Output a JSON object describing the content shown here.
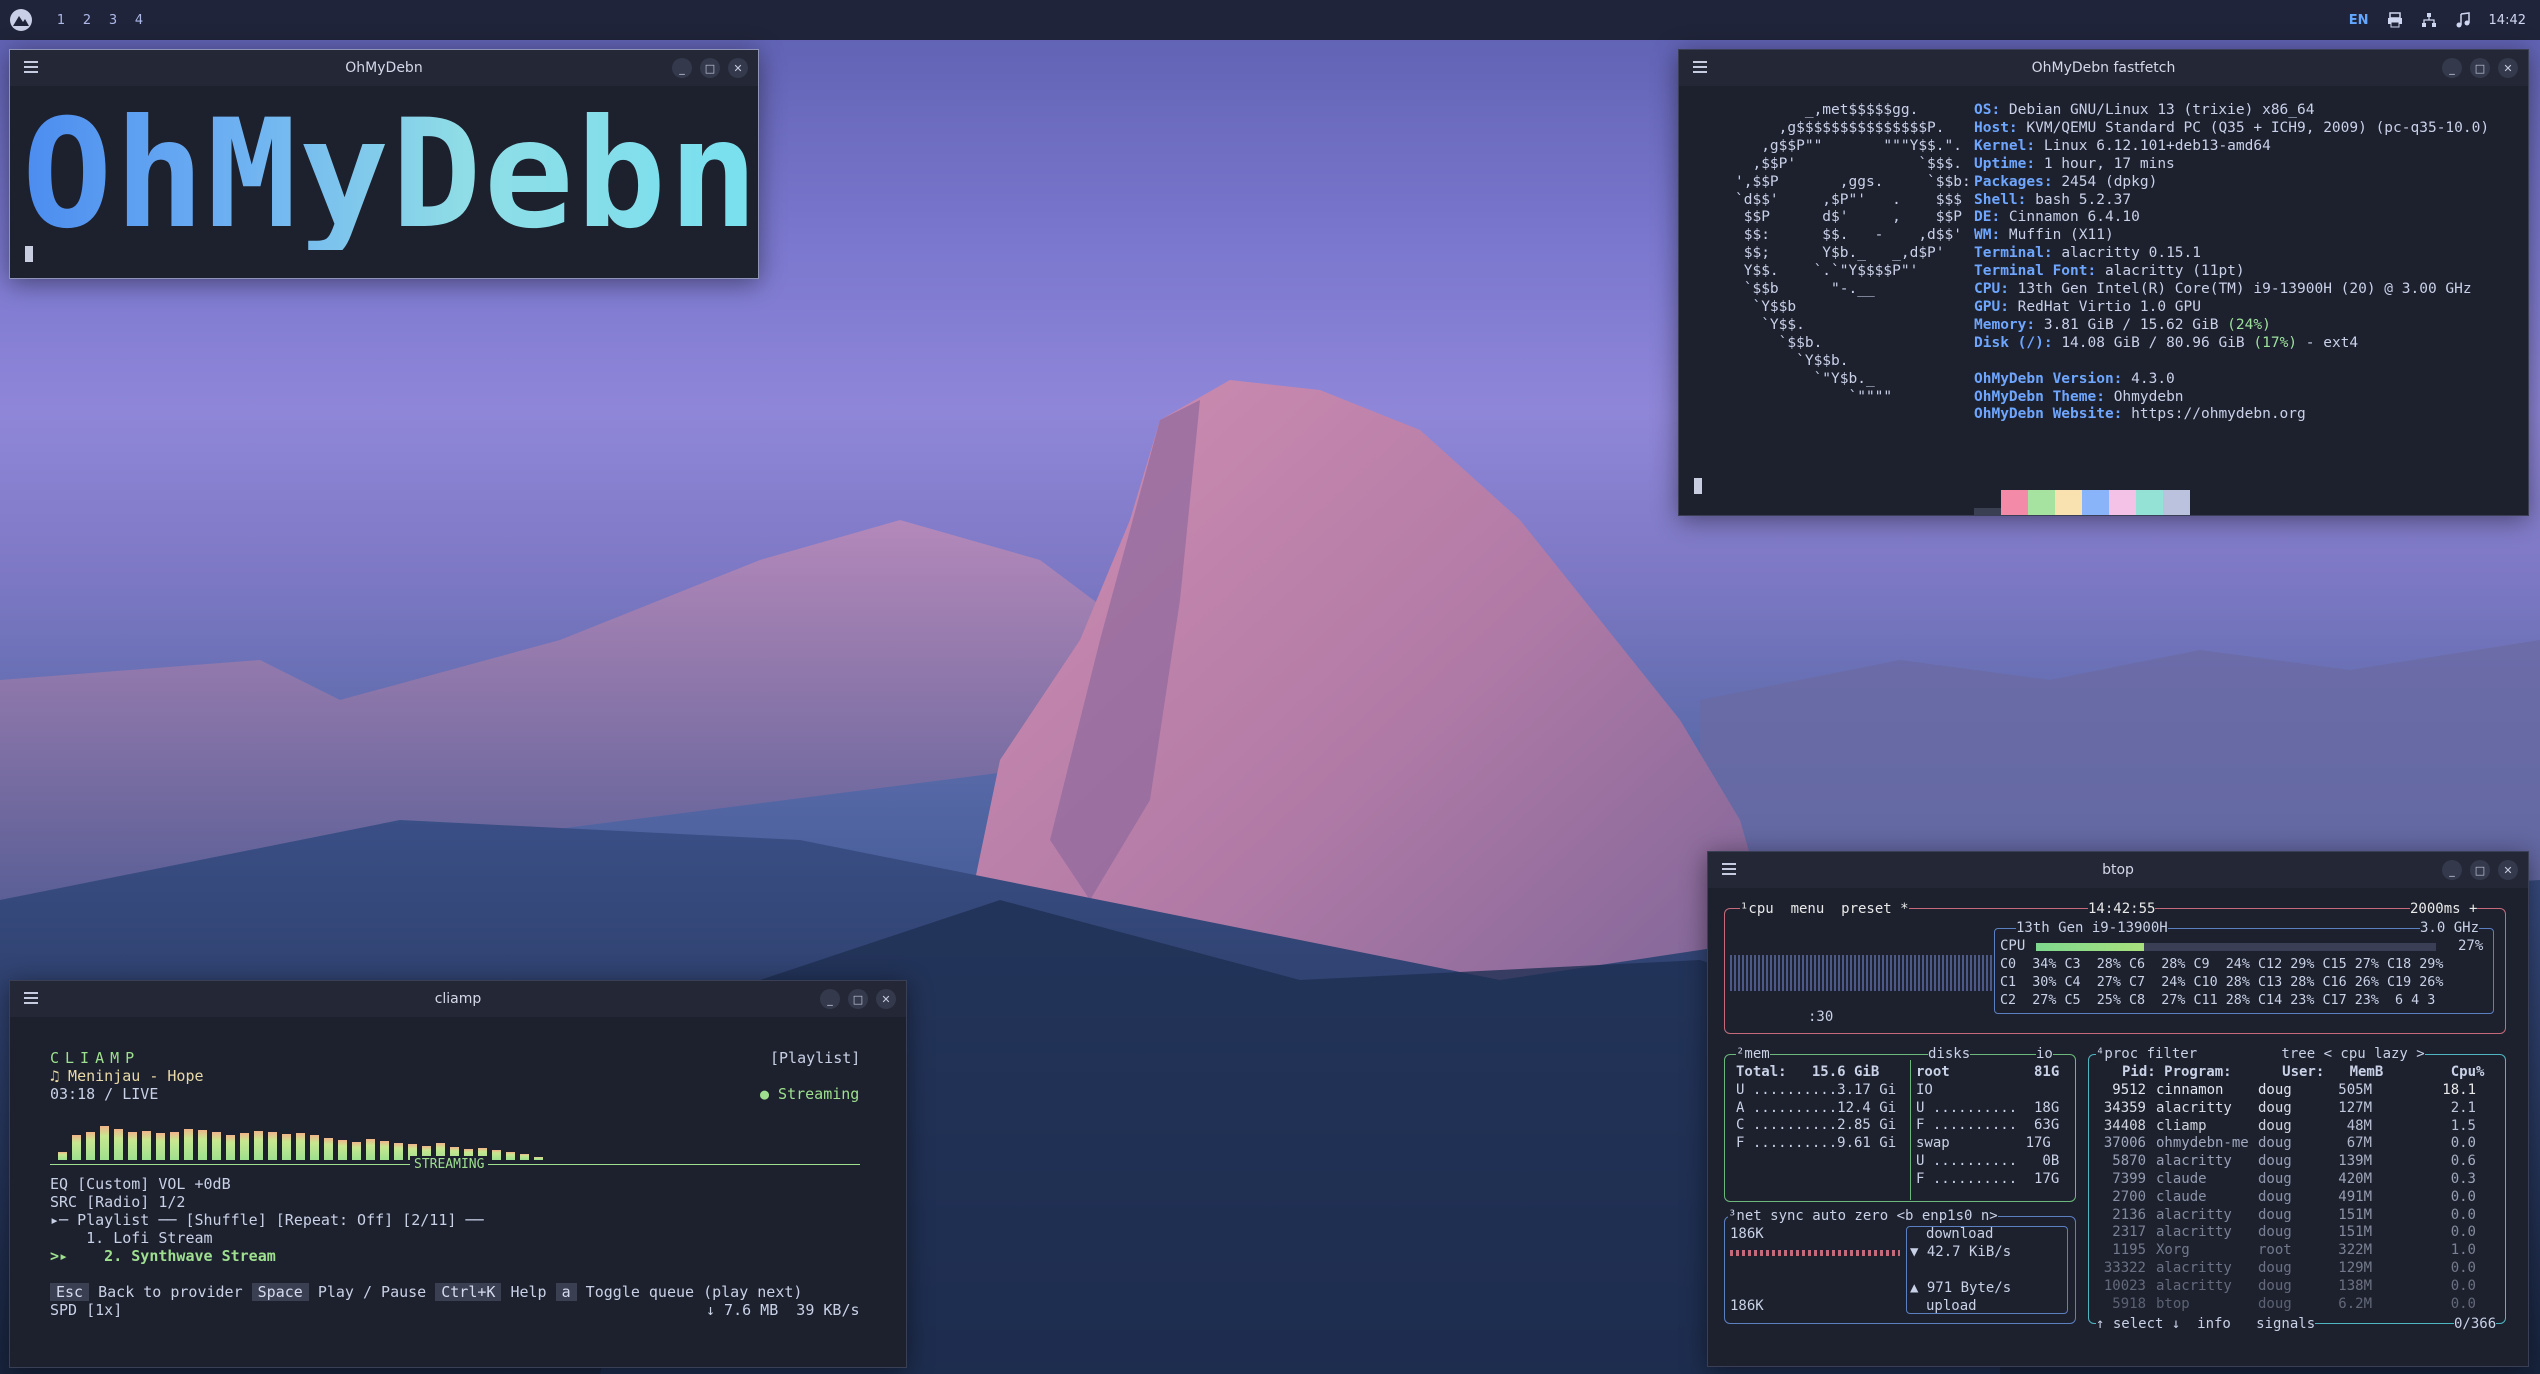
{
  "panel": {
    "workspaces": [
      "1",
      "2",
      "3",
      "4"
    ],
    "language": "EN",
    "clock": "14:42",
    "tray_icons": [
      "printer-icon",
      "network-icon",
      "music-icon"
    ]
  },
  "logo_window": {
    "title": "OhMyDebn",
    "big_text": "OhMyDebn"
  },
  "fastfetch_window": {
    "title": "OhMyDebn fastfetch",
    "ascii": [
      "        _,met$$$$$gg.",
      "     ,g$$$$$$$$$$$$$$$P.",
      "   ,g$$P\"\"       \"\"\"Y$$.\".",
      "  ,$$P'              `$$$.",
      "',$$P       ,ggs.     `$$b:",
      "`d$$'     ,$P\"'   .    $$$",
      " $$P      d$'     ,    $$P",
      " $$:      $$.   -    ,d$$'",
      " $$;      Y$b._   _,d$P'",
      " Y$$.    `.`\"Y$$$$P\"'",
      " `$$b      \"-.__",
      "  `Y$$b",
      "   `Y$$.",
      "     `$$b.",
      "       `Y$$b.",
      "         `\"Y$b._",
      "             `\"\"\"\""
    ],
    "info": [
      {
        "k": "OS",
        "v": "Debian GNU/Linux 13 (trixie) x86_64"
      },
      {
        "k": "Host",
        "v": "KVM/QEMU Standard PC (Q35 + ICH9, 2009) (pc-q35-10.0)"
      },
      {
        "k": "Kernel",
        "v": "Linux 6.12.101+deb13-amd64"
      },
      {
        "k": "Uptime",
        "v": "1 hour, 17 mins"
      },
      {
        "k": "Packages",
        "v": "2454 (dpkg)"
      },
      {
        "k": "Shell",
        "v": "bash 5.2.37"
      },
      {
        "k": "DE",
        "v": "Cinnamon 6.4.10"
      },
      {
        "k": "WM",
        "v": "Muffin (X11)"
      },
      {
        "k": "Terminal",
        "v": "alacritty 0.15.1"
      },
      {
        "k": "Terminal Font",
        "v": "alacritty (11pt)"
      },
      {
        "k": "CPU",
        "v": "13th Gen Intel(R) Core(TM) i9-13900H (20) @ 3.00 GHz"
      },
      {
        "k": "GPU",
        "v": "RedHat Virtio 1.0 GPU"
      },
      {
        "k": "Memory",
        "v": "3.81 GiB / 15.62 GiB ",
        "p": "(24%)"
      },
      {
        "k": "Disk (/)",
        "v": "14.08 GiB / 80.96 GiB ",
        "p": "(17%)",
        "t": " - ext4"
      }
    ],
    "extra": [
      {
        "k": "OhMyDebn Version",
        "v": "4.3.0"
      },
      {
        "k": "OhMyDebn Theme",
        "v": "Ohmydebn"
      },
      {
        "k": "OhMyDebn Website",
        "v": "https://ohmydebn.org"
      }
    ],
    "palette": [
      "#3a3f52",
      "#f38ba8",
      "#a6e3a1",
      "#f9e2af",
      "#89b4fa",
      "#f5c2e7",
      "#94e2d5",
      "#bac2de"
    ]
  },
  "cliamp_window": {
    "title": "cliamp",
    "brand": "CLIAMP",
    "track": "♫ Meninjau - Hope",
    "time": "03:18 / LIVE",
    "mode": "[Playlist]",
    "status": "● Streaming",
    "visualizer_label": "STREAMING",
    "visualizer_levels": [
      0.15,
      0.45,
      0.5,
      0.6,
      0.55,
      0.5,
      0.52,
      0.48,
      0.5,
      0.55,
      0.53,
      0.5,
      0.45,
      0.48,
      0.52,
      0.5,
      0.46,
      0.48,
      0.44,
      0.4,
      0.36,
      0.32,
      0.38,
      0.34,
      0.3,
      0.28,
      0.25,
      0.3,
      0.24,
      0.2,
      0.22,
      0.18,
      0.15,
      0.1,
      0.05
    ],
    "eq": "EQ [Custom] VOL +0dB",
    "src": "SRC [Radio] 1/2",
    "playlist_header": "▸─ Playlist ── [Shuffle] [Repeat: Off] [2/11] ──",
    "items": [
      "    1. Lofi Stream",
      ">▸    2. Synthwave Stream"
    ],
    "keys": [
      {
        "key": "Esc",
        "label": "Back to provider"
      },
      {
        "key": "Space",
        "label": "Play / Pause"
      },
      {
        "key": "Ctrl+K",
        "label": "Help"
      },
      {
        "key": "a",
        "label": "Toggle queue (play next)"
      }
    ],
    "speed": "SPD [1x]",
    "net": "↓ 7.6 MB  39 KB/s"
  },
  "btop_window": {
    "title": "btop",
    "cpu_header": "¹cpu  menu  preset *",
    "clock": "14:42:55",
    "interval": "2000ms +",
    "cpu_model": "13th Gen i9-13900H",
    "freq": "3.0 GHz",
    "cpu_total": "27%",
    "graph_time": ":30",
    "cores": [
      "C0  34% C3  28% C6  28% C9  24% C12 29% C15 27% C18 29%",
      "C1  30% C4  27% C7  24% C10 28% C13 28% C16 26% C19 26%",
      "C2  27% C5  25% C8  27% C11 28% C14 23% C17 23%  6 4 3"
    ],
    "mem_header": "²mem",
    "disks_header": "disks",
    "io_header": "io",
    "mem_lines": [
      "Total:   15.6 GiB",
      "U ..........3.17 Gi",
      "A ..........12.4 Gi",
      "C ..........2.85 Gi",
      "F ..........9.61 Gi"
    ],
    "disk_lines": [
      "root          81G",
      "IO",
      "U ..........  18G",
      "F ..........  63G",
      "swap         17G",
      "U ..........   0B",
      "F ..........  17G"
    ],
    "net_header": "³net sync auto zero <b enp1s0 n>",
    "net_top": "186K",
    "net_bottom": "186K",
    "download_label": "download",
    "download": "▼ 42.7 KiB/s",
    "upload": "▲ 971 Byte/s",
    "upload_label": "upload",
    "proc_header": "⁴proc filter          tree < cpu lazy >",
    "proc_cols": "Pid: Program:      User:   MemB        Cpu%",
    "procs": [
      {
        "pid": "9512",
        "prog": "cinnamon",
        "user": "doug",
        "mem": "505M",
        "cpu": "18.1"
      },
      {
        "pid": "34359",
        "prog": "alacritty",
        "user": "doug",
        "mem": "127M",
        "cpu": "2.1"
      },
      {
        "pid": "34408",
        "prog": "cliamp",
        "user": "doug",
        "mem": "48M",
        "cpu": "1.5"
      },
      {
        "pid": "37006",
        "prog": "ohmydebn-me",
        "user": "doug",
        "mem": "67M",
        "cpu": "0.0"
      },
      {
        "pid": "5870",
        "prog": "alacritty",
        "user": "doug",
        "mem": "139M",
        "cpu": "0.6"
      },
      {
        "pid": "7399",
        "prog": "claude",
        "user": "doug",
        "mem": "420M",
        "cpu": "0.3"
      },
      {
        "pid": "2700",
        "prog": "claude",
        "user": "doug",
        "mem": "491M",
        "cpu": "0.0"
      },
      {
        "pid": "2136",
        "prog": "alacritty",
        "user": "doug",
        "mem": "151M",
        "cpu": "0.0"
      },
      {
        "pid": "2317",
        "prog": "alacritty",
        "user": "doug",
        "mem": "151M",
        "cpu": "0.0"
      },
      {
        "pid": "1195",
        "prog": "Xorg",
        "user": "root",
        "mem": "322M",
        "cpu": "1.0"
      },
      {
        "pid": "33322",
        "prog": "alacritty",
        "user": "doug",
        "mem": "129M",
        "cpu": "0.0"
      },
      {
        "pid": "10023",
        "prog": "alacritty",
        "user": "doug",
        "mem": "138M",
        "cpu": "0.0"
      },
      {
        "pid": "5918",
        "prog": "btop",
        "user": "doug",
        "mem": "6.2M",
        "cpu": "0.0"
      }
    ],
    "proc_footer": "↑ select ↓  info   signals",
    "proc_count": "0/366"
  }
}
